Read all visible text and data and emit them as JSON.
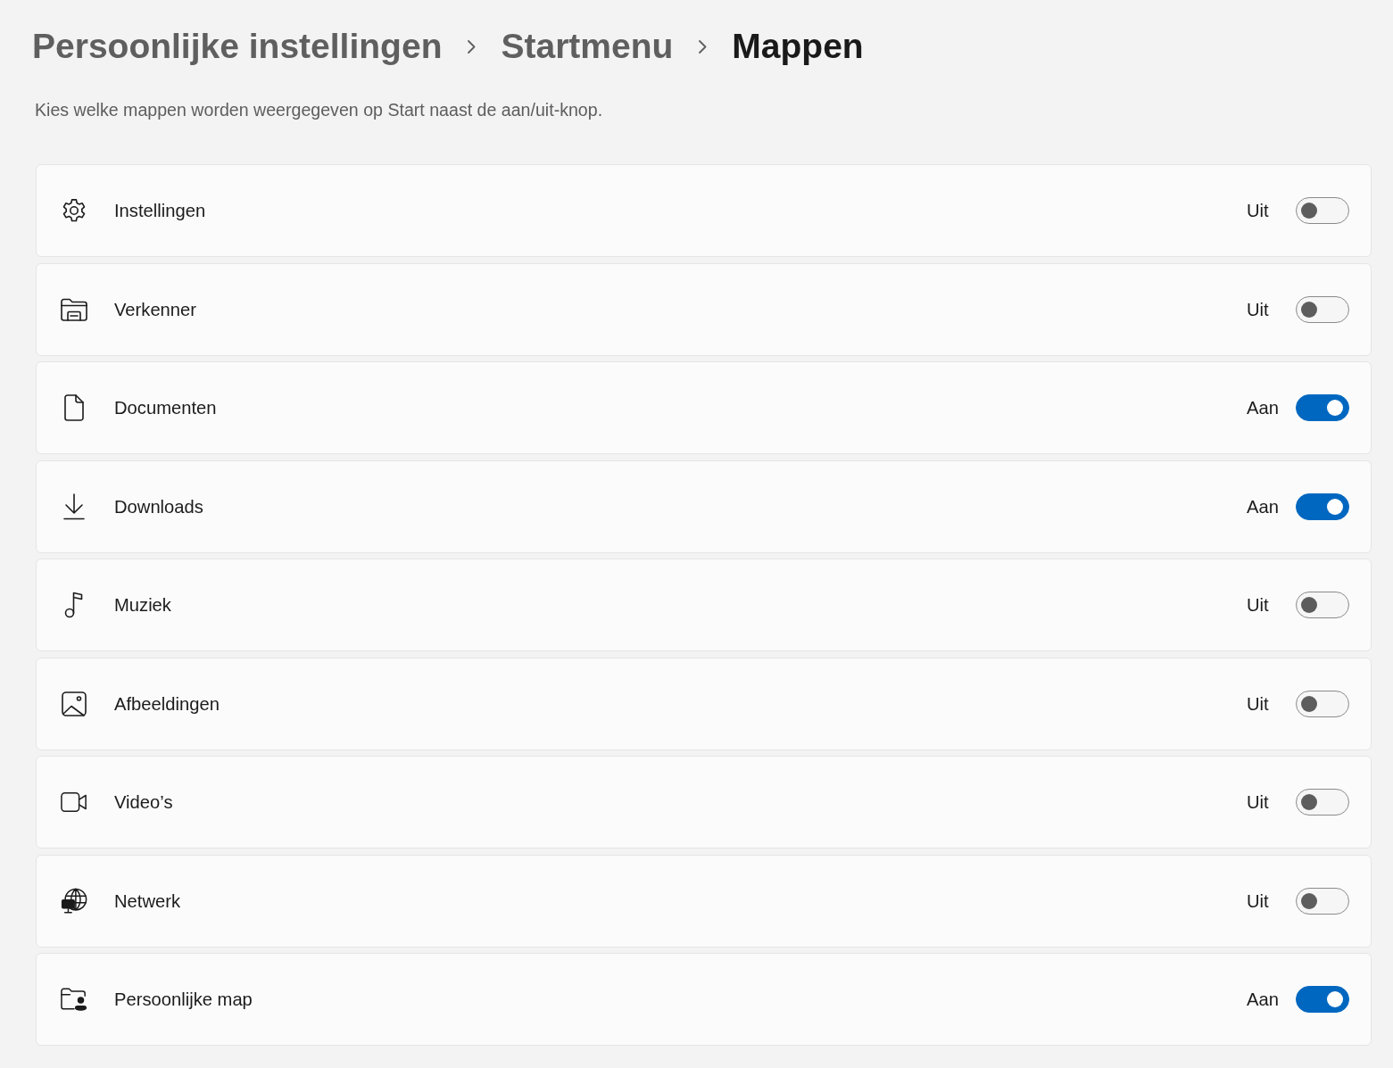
{
  "breadcrumb": [
    {
      "label": "Persoonlijke instellingen",
      "current": false
    },
    {
      "label": "Startmenu",
      "current": false
    },
    {
      "label": "Mappen",
      "current": true
    }
  ],
  "description": "Kies welke mappen worden weergegeven op Start naast de aan/uit-knop.",
  "folders": [
    {
      "label": "Instellingen",
      "state_label": "Uit",
      "on": false
    },
    {
      "label": "Verkenner",
      "state_label": "Uit",
      "on": false
    },
    {
      "label": "Documenten",
      "state_label": "Aan",
      "on": true
    },
    {
      "label": "Downloads",
      "state_label": "Aan",
      "on": true
    },
    {
      "label": "Muziek",
      "state_label": "Uit",
      "on": false
    },
    {
      "label": "Afbeeldingen",
      "state_label": "Uit",
      "on": false
    },
    {
      "label": "Video’s",
      "state_label": "Uit",
      "on": false
    },
    {
      "label": "Netwerk",
      "state_label": "Uit",
      "on": false
    },
    {
      "label": "Persoonlijke map",
      "state_label": "Aan",
      "on": true
    }
  ]
}
